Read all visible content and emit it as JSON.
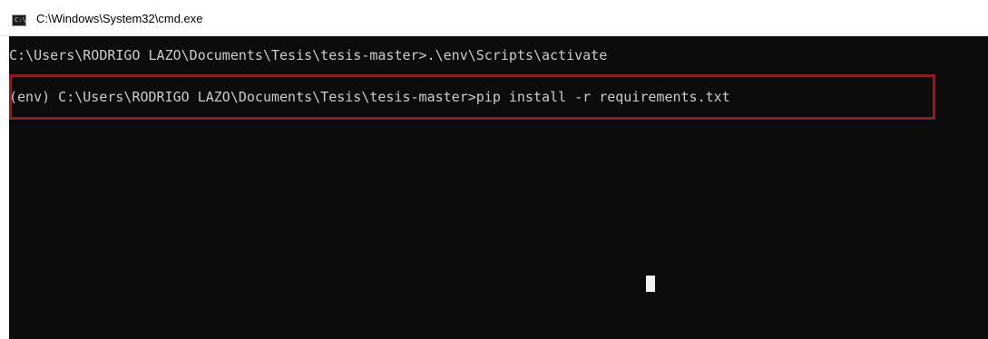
{
  "window": {
    "title": "C:\\Windows\\System32\\cmd.exe",
    "icon": "cmd-icon",
    "icon_text": "C:\\"
  },
  "console": {
    "lines": [
      "C:\\Users\\RODRIGO LAZO\\Documents\\Tesis\\tesis-master>.\\env\\Scripts\\activate",
      "(env) C:\\Users\\RODRIGO LAZO\\Documents\\Tesis\\tesis-master>pip install -r requirements.txt"
    ],
    "background_color": "#0c0c0c",
    "text_color": "#cccccc",
    "highlight_color": "#8b1d25"
  }
}
